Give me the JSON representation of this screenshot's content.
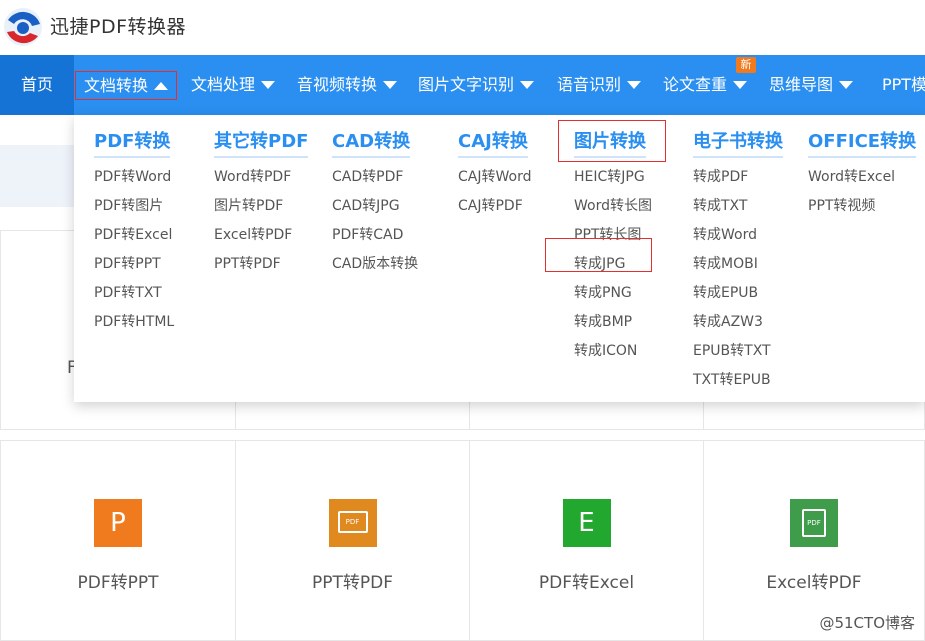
{
  "header": {
    "title": "迅捷PDF转换器",
    "logo_icon": "app-logo-icon"
  },
  "nav": {
    "home": "首页",
    "items": [
      "文档转换",
      "文档处理",
      "音视频转换",
      "图片文字识别",
      "语音识别",
      "论文查重",
      "思维导图",
      "PPT模"
    ],
    "new_badge": "新"
  },
  "dropdown": {
    "columns": [
      {
        "title": "PDF转换",
        "items": [
          "PDF转Word",
          "PDF转图片",
          "PDF转Excel",
          "PDF转PPT",
          "PDF转TXT",
          "PDF转HTML"
        ]
      },
      {
        "title": "其它转PDF",
        "items": [
          "Word转PDF",
          "图片转PDF",
          "Excel转PDF",
          "PPT转PDF"
        ]
      },
      {
        "title": "CAD转换",
        "items": [
          "CAD转PDF",
          "CAD转JPG",
          "PDF转CAD",
          "CAD版本转换"
        ]
      },
      {
        "title": "CAJ转换",
        "items": [
          "CAJ转Word",
          "CAJ转PDF"
        ]
      },
      {
        "title": "图片转换",
        "items": [
          "HEIC转JPG",
          "Word转长图",
          "PPT转长图",
          "转成JPG",
          "转成PNG",
          "转成BMP",
          "转成ICON"
        ]
      },
      {
        "title": "电子书转换",
        "items": [
          "转成PDF",
          "转成TXT",
          "转成Word",
          "转成MOBI",
          "转成EPUB",
          "转成AZW3",
          "EPUB转TXT",
          "TXT转EPUB"
        ]
      },
      {
        "title": "OFFICE转换",
        "items": [
          "Word转Excel",
          "PPT转视频"
        ]
      }
    ]
  },
  "cards_row1": {
    "partial_label": "F"
  },
  "cards_row2": [
    {
      "label": "PDF转PPT",
      "icon_text": "P",
      "color": "#f07a1e",
      "icon": "ppt-letter-icon"
    },
    {
      "label": "PPT转PDF",
      "icon_text": "PDF",
      "color": "#e0891e",
      "icon": "pdf-frame-icon"
    },
    {
      "label": "PDF转Excel",
      "icon_text": "E",
      "color": "#22a82e",
      "icon": "excel-letter-icon"
    },
    {
      "label": "Excel转PDF",
      "icon_text": "PDF",
      "color": "#3e9c4a",
      "icon": "pdf-document-icon"
    }
  ],
  "watermark": "@51CTO博客",
  "colors": {
    "nav_bg": "#2a8ff0",
    "nav_home_bg": "#1673d6",
    "accent": "#2a8ff0",
    "highlight_box": "#e03030",
    "badge": "#f07a1e"
  }
}
